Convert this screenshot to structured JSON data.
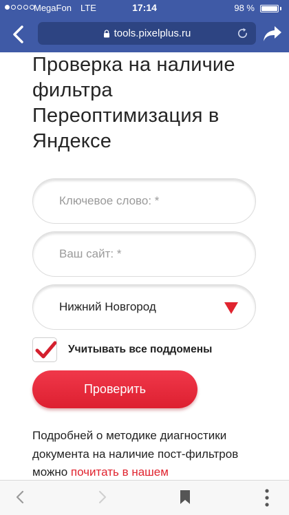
{
  "status_bar": {
    "carrier": "MegaFon",
    "network": "LTE",
    "time": "17:14",
    "battery": "98 %",
    "battery_level": 0.98
  },
  "browser": {
    "url": "tools.pixelplus.ru"
  },
  "page": {
    "title": "Проверка на наличие фильтра Переоптимизация в Яндексе",
    "keyword_placeholder": "Ключевое слово: *",
    "site_placeholder": "Ваш сайт: *",
    "region_selected": "Нижний Новгород",
    "subdomains_label": "Учитывать все поддомены",
    "subdomains_checked": true,
    "submit_label": "Проверить",
    "description_text": "Подробней о методике диагностики документа на наличие пост-фильтров можно ",
    "description_link": "почитать в нашем"
  },
  "icons": {
    "back": "chevron-left-icon",
    "lock": "lock-icon",
    "reload": "reload-icon",
    "share": "share-icon",
    "dropdown": "triangle-down-icon",
    "check": "check-icon",
    "bookmark": "bookmark-icon",
    "menu": "vertical-dots-icon"
  },
  "colors": {
    "header_bg": "#3f5aa6",
    "url_bg": "#2d4482",
    "accent_red": "#e0242f"
  }
}
